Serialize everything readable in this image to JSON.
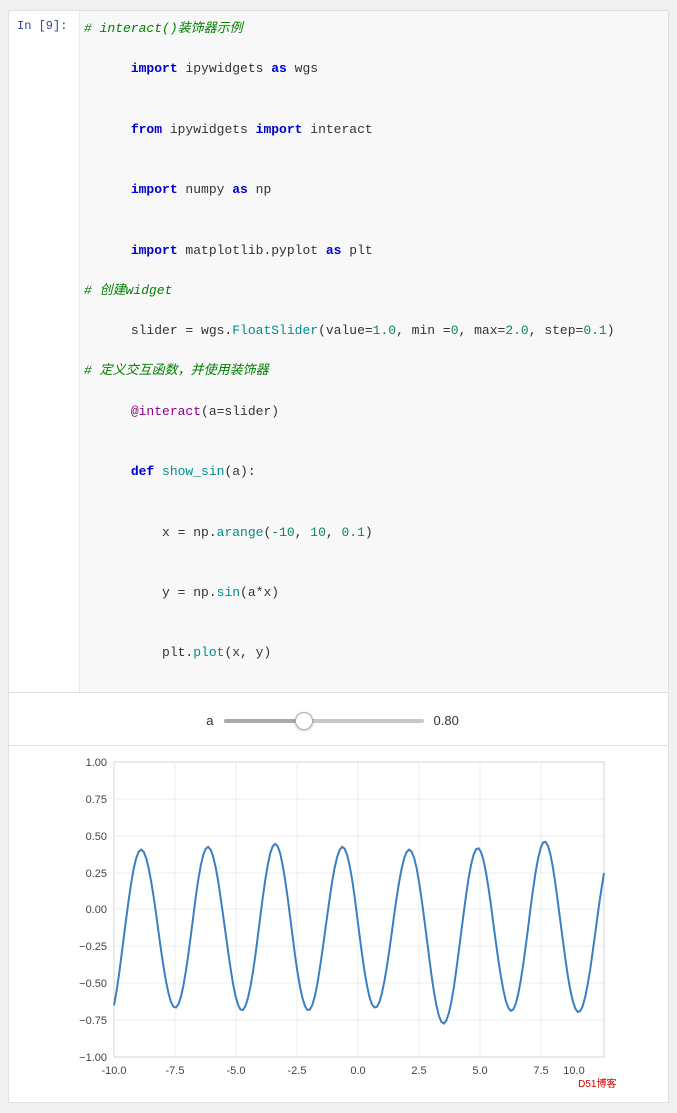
{
  "cell": {
    "label": "In  [9]:",
    "lines": [
      {
        "id": "l1",
        "text": "# interact()装饰器示例",
        "type": "comment"
      },
      {
        "id": "l2",
        "text": "import ipywidgets as wgs",
        "type": "code"
      },
      {
        "id": "l3",
        "text": "from ipywidgets import interact",
        "type": "code"
      },
      {
        "id": "l4",
        "text": "import numpy as np",
        "type": "code"
      },
      {
        "id": "l5",
        "text": "import matplotlib.pyplot as plt",
        "type": "code"
      },
      {
        "id": "l6",
        "text": "# 创建widget",
        "type": "comment"
      },
      {
        "id": "l7",
        "text": "slider = wgs.FloatSlider(value=1.0, min =0, max=2.0, step=0.1)",
        "type": "code"
      },
      {
        "id": "l8",
        "text": "# 定义交互函数，并使用装饰器",
        "type": "comment"
      },
      {
        "id": "l9",
        "text": "@interact(a=slider)",
        "type": "decorator"
      },
      {
        "id": "l10",
        "text": "def show_sin(a):",
        "type": "code"
      },
      {
        "id": "l11",
        "text": "    x = np.arange(-10, 10, 0.1)",
        "type": "code"
      },
      {
        "id": "l12",
        "text": "    y = np.sin(a*x)",
        "type": "code"
      },
      {
        "id": "l13",
        "text": "    plt.plot(x, y)",
        "type": "code"
      }
    ]
  },
  "widget": {
    "label": "a",
    "value": "0.80",
    "min": 0,
    "max": 2.0,
    "current": 0.8,
    "percent": 40
  },
  "chart": {
    "x_labels": [
      "-10.0",
      "-7.5",
      "-5.0",
      "-2.5",
      "0.0",
      "2.5",
      "5.0",
      "7.5",
      "10.0"
    ],
    "y_labels": [
      "1.00",
      "0.75",
      "0.50",
      "0.25",
      "0.00",
      "-0.25",
      "-0.50",
      "-0.75",
      "-1.00"
    ],
    "watermark": "D51博客"
  }
}
